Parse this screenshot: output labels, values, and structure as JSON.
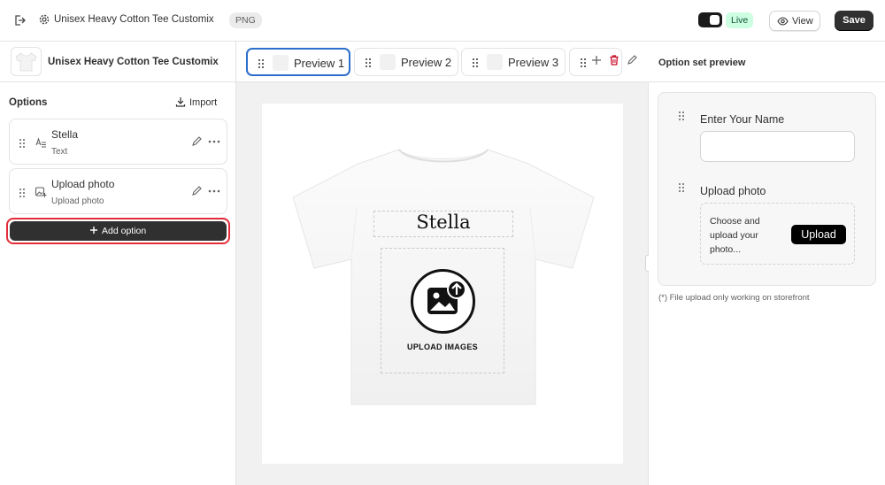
{
  "topbar": {
    "title": "Unisex Heavy Cotton Tee Customix",
    "format_badge": "PNG",
    "live_label": "Live",
    "view_label": "View",
    "save_label": "Save"
  },
  "left_panel": {
    "product_title": "Unisex Heavy Cotton Tee Customix",
    "options_label": "Options",
    "import_label": "Import",
    "options": [
      {
        "name": "Stella",
        "type": "Text"
      },
      {
        "name": "Upload photo",
        "type": "Upload photo"
      }
    ],
    "add_option_label": "Add option"
  },
  "center": {
    "tabs": [
      {
        "label": "Preview 1",
        "active": true
      },
      {
        "label": "Preview 2",
        "active": false
      },
      {
        "label": "Preview 3",
        "active": false
      }
    ],
    "canvas": {
      "text_layer": "Stella",
      "image_layer_label": "UPLOAD IMAGES"
    }
  },
  "right_panel": {
    "title": "Option set preview",
    "fields": [
      {
        "label": "Enter Your Name"
      },
      {
        "label": "Upload photo",
        "hint": "Choose and upload your photo...",
        "button": "Upload"
      }
    ],
    "note": "(*) File upload only working on storefront"
  },
  "colors": {
    "accent_blue": "#2c6ecb",
    "highlight_red": "#e22c38",
    "live_green_bg": "#cdfee1",
    "dark_button": "#303030"
  }
}
